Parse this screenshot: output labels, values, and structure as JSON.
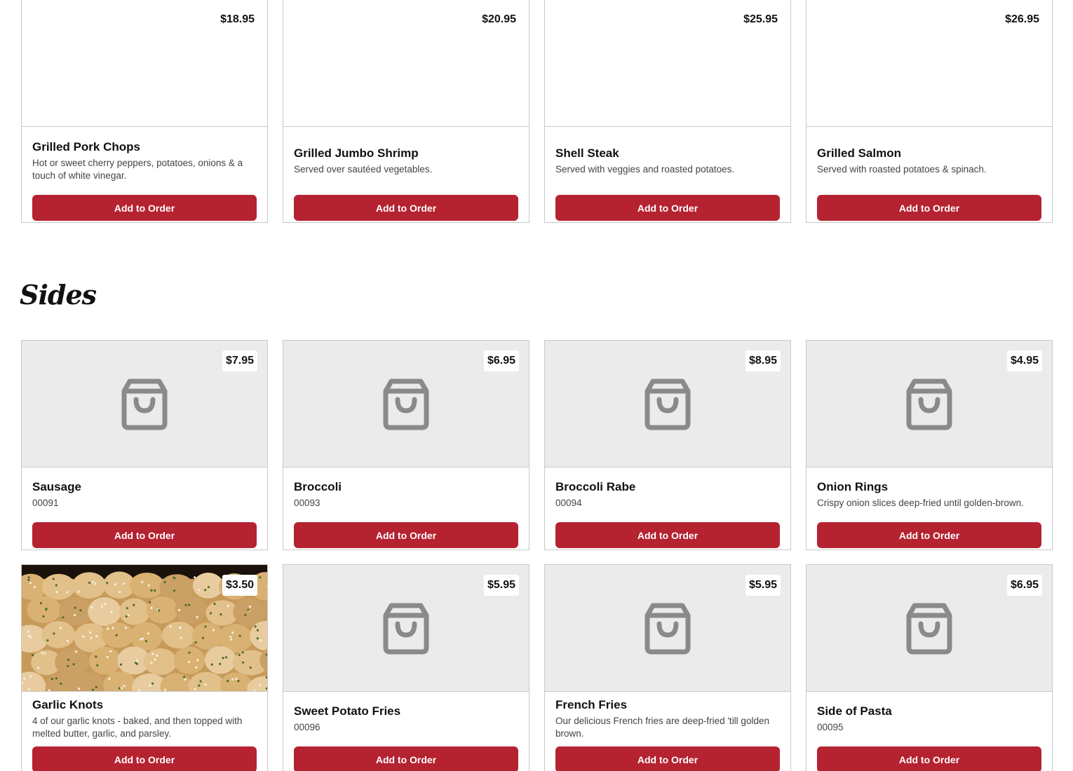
{
  "entrees": [
    {
      "name": "Grilled Pork Chops",
      "description": "Hot or sweet cherry peppers, potatoes, onions & a touch of white vinegar.",
      "price": "$18.95",
      "button": "Add to Order"
    },
    {
      "name": "Grilled Jumbo Shrimp",
      "description": "Served over sautéed vegetables.",
      "price": "$20.95",
      "button": "Add to Order"
    },
    {
      "name": "Shell Steak",
      "description": "Served with veggies and roasted potatoes.",
      "price": "$25.95",
      "button": "Add to Order"
    },
    {
      "name": "Grilled Salmon",
      "description": "Served with roasted potatoes & spinach.",
      "price": "$26.95",
      "button": "Add to Order"
    }
  ],
  "sides": {
    "title": "Sides",
    "items": [
      {
        "name": "Sausage",
        "description": "00091",
        "price": "$7.95",
        "button": "Add to Order",
        "image": "shopping-bag-placeholder"
      },
      {
        "name": "Broccoli",
        "description": "00093",
        "price": "$6.95",
        "button": "Add to Order",
        "image": "shopping-bag-placeholder"
      },
      {
        "name": "Broccoli Rabe",
        "description": "00094",
        "price": "$8.95",
        "button": "Add to Order",
        "image": "shopping-bag-placeholder"
      },
      {
        "name": "Onion Rings",
        "description": "Crispy onion slices deep-fried until golden-brown.",
        "price": "$4.95",
        "button": "Add to Order",
        "image": "shopping-bag-placeholder"
      },
      {
        "name": "Garlic Knots",
        "description": "4 of our garlic knots - baked, and then topped with melted butter, garlic, and parsley.",
        "price": "$3.50",
        "button": "Add to Order",
        "image": "garlic-knots-photo"
      },
      {
        "name": "Sweet Potato Fries",
        "description": "00096",
        "price": "$5.95",
        "button": "Add to Order",
        "image": "shopping-bag-placeholder"
      },
      {
        "name": "French Fries",
        "description": "Our delicious French fries are deep-fried 'till golden brown.",
        "price": "$5.95",
        "button": "Add to Order",
        "image": "shopping-bag-placeholder"
      },
      {
        "name": "Side of Pasta",
        "description": "00095",
        "price": "$6.95",
        "button": "Add to Order",
        "image": "shopping-bag-placeholder"
      }
    ]
  },
  "colors": {
    "button": "#b52230",
    "placeholder_bg": "#ebebeb",
    "icon": "#8a8a8a"
  }
}
